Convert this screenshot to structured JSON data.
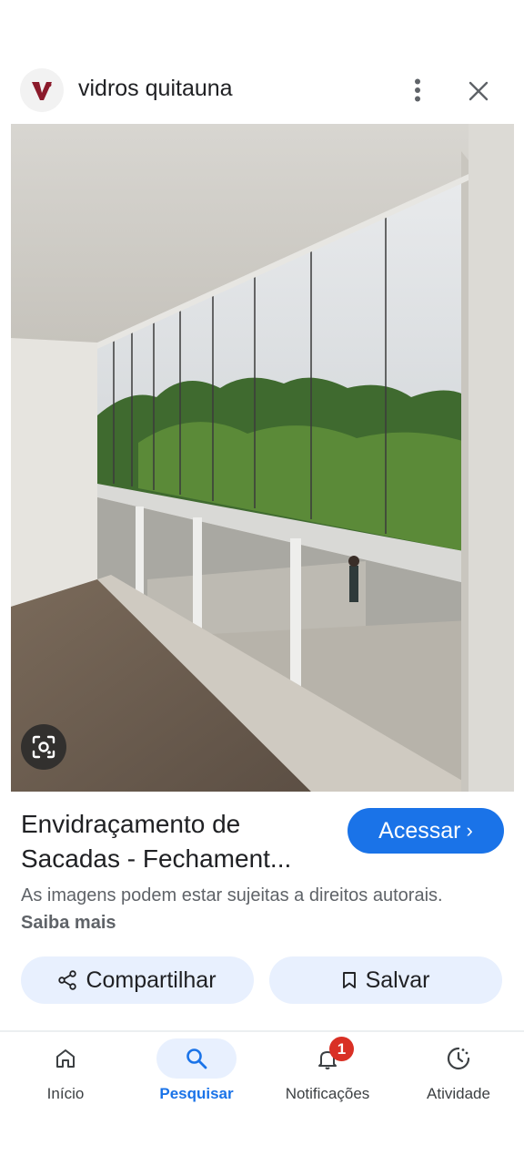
{
  "header": {
    "site_name": "vidros quitauna",
    "logo_icon": "brand-logo-icon",
    "more_icon": "more-vertical-icon",
    "close_icon": "close-icon"
  },
  "image": {
    "description_icon": "photo-balcony-glass",
    "lens_icon": "lens-search-icon"
  },
  "result": {
    "title_line1": "Envidraçamento de",
    "title_line2": "Sacadas - Fechament...",
    "visit_label": "Acessar",
    "visit_chevron": "›",
    "copyright_text": "As imagens podem estar sujeitas a direitos autorais.",
    "learn_more": "Saiba mais"
  },
  "actions": {
    "share_label": "Compartilhar",
    "save_label": "Salvar"
  },
  "nav": {
    "items": [
      {
        "label": "Início",
        "icon": "home-icon"
      },
      {
        "label": "Pesquisar",
        "icon": "search-icon"
      },
      {
        "label": "Notificações",
        "icon": "bell-icon",
        "badge": "1"
      },
      {
        "label": "Atividade",
        "icon": "activity-icon"
      }
    ]
  },
  "colors": {
    "accent": "#1a73e8",
    "badge": "#d93025",
    "tonal_button": "#e8f0fe"
  }
}
